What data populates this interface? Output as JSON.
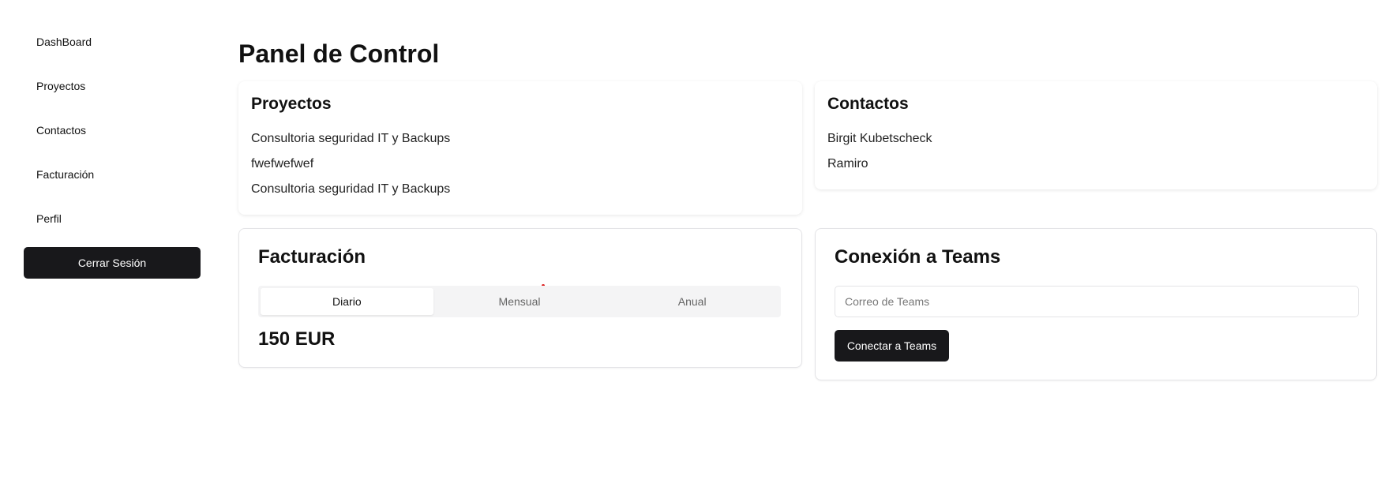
{
  "sidebar": {
    "items": [
      {
        "label": "DashBoard"
      },
      {
        "label": "Proyectos"
      },
      {
        "label": "Contactos"
      },
      {
        "label": "Facturación"
      },
      {
        "label": "Perfil"
      }
    ],
    "logout_label": "Cerrar Sesión"
  },
  "main": {
    "title": "Panel de Control",
    "projects": {
      "title": "Proyectos",
      "items": [
        "Consultoria seguridad IT y Backups",
        "fwefwefwef",
        "Consultoria seguridad IT y Backups"
      ]
    },
    "contacts": {
      "title": "Contactos",
      "items": [
        "Birgit Kubetscheck",
        "Ramiro"
      ]
    },
    "billing": {
      "title": "Facturación",
      "tabs": [
        "Diario",
        "Mensual",
        "Anual"
      ],
      "active_tab": "Diario",
      "amount": "150 EUR"
    },
    "teams": {
      "title": "Conexión a Teams",
      "email_placeholder": "Correo de Teams",
      "email_value": "",
      "connect_label": "Conectar a Teams"
    }
  },
  "colors": {
    "primary_button": "#18181b",
    "tab_background": "#f4f4f5",
    "border": "#e4e4e7"
  }
}
